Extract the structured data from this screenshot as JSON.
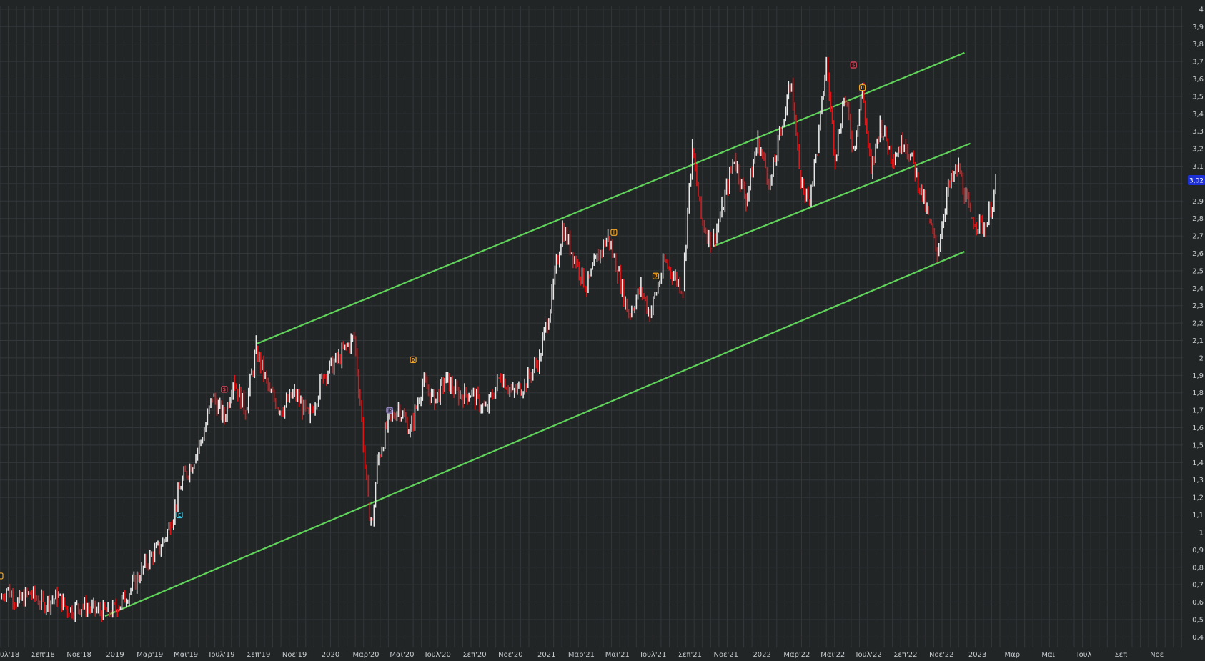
{
  "chart_data": {
    "type": "line",
    "title": "",
    "colors": {
      "background": "#222526",
      "grid": "#33373a",
      "axis_text": "#c9cccf",
      "price_up": "#e8e8e8",
      "price_down": "#d7191c",
      "trendline": "#5fd35a",
      "last_price_badge": "#1d2fd6"
    },
    "grid": true,
    "x_axis": {
      "type": "date",
      "range": [
        "2018-06-20",
        "2023-12-15"
      ],
      "ticks": [
        {
          "date": "2018-07-01",
          "label": "Ιουλ'18"
        },
        {
          "date": "2018-09-01",
          "label": "Σεπ'18"
        },
        {
          "date": "2018-11-01",
          "label": "Νοε'18"
        },
        {
          "date": "2019-01-01",
          "label": "2019"
        },
        {
          "date": "2019-03-01",
          "label": "Μαρ'19"
        },
        {
          "date": "2019-05-01",
          "label": "Μαι'19"
        },
        {
          "date": "2019-07-01",
          "label": "Ιουλ'19"
        },
        {
          "date": "2019-09-01",
          "label": "Σεπ'19"
        },
        {
          "date": "2019-11-01",
          "label": "Νοε'19"
        },
        {
          "date": "2020-01-01",
          "label": "2020"
        },
        {
          "date": "2020-03-01",
          "label": "Μαρ'20"
        },
        {
          "date": "2020-05-01",
          "label": "Μαι'20"
        },
        {
          "date": "2020-07-01",
          "label": "Ιουλ'20"
        },
        {
          "date": "2020-09-01",
          "label": "Σεπ'20"
        },
        {
          "date": "2020-11-01",
          "label": "Νοε'20"
        },
        {
          "date": "2021-01-01",
          "label": "2021"
        },
        {
          "date": "2021-03-01",
          "label": "Μαρ'21"
        },
        {
          "date": "2021-05-01",
          "label": "Μαι'21"
        },
        {
          "date": "2021-07-01",
          "label": "Ιουλ'21"
        },
        {
          "date": "2021-09-01",
          "label": "Σεπ'21"
        },
        {
          "date": "2021-11-01",
          "label": "Νοε'21"
        },
        {
          "date": "2022-01-01",
          "label": "2022"
        },
        {
          "date": "2022-03-01",
          "label": "Μαρ'22"
        },
        {
          "date": "2022-05-01",
          "label": "Μαι'22"
        },
        {
          "date": "2022-07-01",
          "label": "Ιουλ'22"
        },
        {
          "date": "2022-09-01",
          "label": "Σεπ'22"
        },
        {
          "date": "2022-11-01",
          "label": "Νοε'22"
        },
        {
          "date": "2023-01-01",
          "label": "2023"
        },
        {
          "date": "2023-03-01",
          "label": "Μαρ"
        },
        {
          "date": "2023-05-01",
          "label": "Μαι"
        },
        {
          "date": "2023-07-01",
          "label": "Ιουλ"
        },
        {
          "date": "2023-09-01",
          "label": "Σεπ"
        },
        {
          "date": "2023-11-01",
          "label": "Νοε"
        }
      ]
    },
    "y_axis": {
      "position": "right",
      "range": [
        0.34,
        4.02
      ],
      "ticks": [
        {
          "value": 0.4,
          "label": "0,4"
        },
        {
          "value": 0.5,
          "label": "0,5"
        },
        {
          "value": 0.6,
          "label": "0,6"
        },
        {
          "value": 0.7,
          "label": "0,7"
        },
        {
          "value": 0.8,
          "label": "0,8"
        },
        {
          "value": 0.9,
          "label": "0,9"
        },
        {
          "value": 1.0,
          "label": "1"
        },
        {
          "value": 1.1,
          "label": "1,1"
        },
        {
          "value": 1.2,
          "label": "1,2"
        },
        {
          "value": 1.3,
          "label": "1,3"
        },
        {
          "value": 1.4,
          "label": "1,4"
        },
        {
          "value": 1.5,
          "label": "1,5"
        },
        {
          "value": 1.6,
          "label": "1,6"
        },
        {
          "value": 1.7,
          "label": "1,7"
        },
        {
          "value": 1.8,
          "label": "1,8"
        },
        {
          "value": 1.9,
          "label": "1,9"
        },
        {
          "value": 2.0,
          "label": "2"
        },
        {
          "value": 2.1,
          "label": "2,1"
        },
        {
          "value": 2.2,
          "label": "2,2"
        },
        {
          "value": 2.3,
          "label": "2,3"
        },
        {
          "value": 2.4,
          "label": "2,4"
        },
        {
          "value": 2.5,
          "label": "2,5"
        },
        {
          "value": 2.6,
          "label": "2,6"
        },
        {
          "value": 2.7,
          "label": "2,7"
        },
        {
          "value": 2.8,
          "label": "2,8"
        },
        {
          "value": 2.9,
          "label": "2,9"
        },
        {
          "value": 3.0,
          "label": ""
        },
        {
          "value": 3.1,
          "label": "3,1"
        },
        {
          "value": 3.2,
          "label": "3,2"
        },
        {
          "value": 3.3,
          "label": "3,3"
        },
        {
          "value": 3.4,
          "label": "3,4"
        },
        {
          "value": 3.5,
          "label": "3,5"
        },
        {
          "value": 3.6,
          "label": "3,6"
        },
        {
          "value": 3.7,
          "label": "3,7"
        },
        {
          "value": 3.8,
          "label": "3,8"
        },
        {
          "value": 3.9,
          "label": "3,9"
        },
        {
          "value": 4.0,
          "label": "4"
        }
      ]
    },
    "last_price": {
      "value": 3.02,
      "label": "3,02"
    },
    "series": [
      {
        "x": [
          "2018-06-20",
          "2018-07-01",
          "2018-07-20",
          "2018-08-10",
          "2018-09-01",
          "2018-09-25",
          "2018-10-15",
          "2018-11-05",
          "2018-12-01",
          "2018-12-20",
          "2019-01-05",
          "2019-01-25",
          "2019-02-15",
          "2019-03-01",
          "2019-03-20",
          "2019-04-05",
          "2019-04-25",
          "2019-05-15",
          "2019-06-01",
          "2019-06-15",
          "2019-07-05",
          "2019-07-20",
          "2019-08-10",
          "2019-08-28",
          "2019-09-20",
          "2019-10-10",
          "2019-11-01",
          "2019-11-25",
          "2019-12-20",
          "2020-01-15",
          "2020-02-10",
          "2020-02-20",
          "2020-03-05",
          "2020-03-12",
          "2020-03-20",
          "2020-04-05",
          "2020-04-25",
          "2020-05-15",
          "2020-06-05",
          "2020-06-25",
          "2020-07-15",
          "2020-08-05",
          "2020-08-25",
          "2020-09-20",
          "2020-10-15",
          "2020-11-05",
          "2020-11-25",
          "2020-12-20",
          "2021-01-10",
          "2021-01-28",
          "2021-02-20",
          "2021-03-10",
          "2021-03-25",
          "2021-04-15",
          "2021-05-01",
          "2021-05-20",
          "2021-06-10",
          "2021-06-25",
          "2021-07-20",
          "2021-08-20",
          "2021-08-28",
          "2021-09-05",
          "2021-09-20",
          "2021-10-08",
          "2021-10-25",
          "2021-11-15",
          "2021-12-05",
          "2021-12-25",
          "2022-01-15",
          "2022-02-05",
          "2022-02-20",
          "2022-03-05",
          "2022-03-20",
          "2022-04-05",
          "2022-04-20",
          "2022-05-05",
          "2022-05-20",
          "2022-06-05",
          "2022-06-20",
          "2022-07-05",
          "2022-07-20",
          "2022-08-10",
          "2022-08-30",
          "2022-09-20",
          "2022-10-10",
          "2022-10-25",
          "2022-11-10",
          "2022-11-30",
          "2022-12-20",
          "2023-01-15",
          "2023-02-01"
        ],
        "y": [
          0.62,
          0.68,
          0.6,
          0.65,
          0.59,
          0.63,
          0.55,
          0.58,
          0.55,
          0.54,
          0.57,
          0.66,
          0.78,
          0.86,
          0.92,
          1.05,
          1.3,
          1.42,
          1.58,
          1.78,
          1.65,
          1.88,
          1.7,
          2.05,
          1.8,
          1.7,
          1.8,
          1.65,
          1.9,
          2.0,
          2.12,
          1.75,
          1.15,
          1.05,
          1.4,
          1.6,
          1.72,
          1.58,
          1.86,
          1.75,
          1.88,
          1.78,
          1.8,
          1.7,
          1.9,
          1.8,
          1.85,
          2.0,
          2.35,
          2.75,
          2.55,
          2.4,
          2.55,
          2.7,
          2.5,
          2.25,
          2.4,
          2.25,
          2.55,
          2.4,
          2.85,
          3.2,
          2.8,
          2.65,
          2.85,
          3.15,
          2.9,
          3.25,
          3.0,
          3.35,
          3.6,
          3.05,
          2.9,
          3.2,
          3.7,
          3.15,
          3.5,
          3.2,
          3.55,
          3.05,
          3.35,
          3.15,
          3.25,
          3.05,
          2.8,
          2.6,
          2.95,
          3.1,
          2.8,
          2.75,
          2.98
        ]
      }
    ],
    "trendlines": [
      {
        "name": "upper",
        "from": {
          "date": "2019-08-28",
          "value": 2.08
        },
        "to": {
          "date": "2022-12-10",
          "value": 3.75
        }
      },
      {
        "name": "lower",
        "from": {
          "date": "2018-12-15",
          "value": 0.52
        },
        "to": {
          "date": "2022-12-10",
          "value": 2.61
        }
      },
      {
        "name": "inner",
        "from": {
          "date": "2021-10-10",
          "value": 2.64
        },
        "to": {
          "date": "2022-12-20",
          "value": 3.23
        }
      }
    ],
    "event_markers": [
      {
        "date": "2018-06-20",
        "value": 0.75,
        "text": "",
        "color": "#f5a623"
      },
      {
        "date": "2019-04-20",
        "value": 1.1,
        "text": "E",
        "color": "#3ac5e0"
      },
      {
        "date": "2019-07-05",
        "value": 1.82,
        "text": "S",
        "color": "#e84a5f"
      },
      {
        "date": "2020-04-10",
        "value": 1.7,
        "text": "ES",
        "color": "#b8a6f0"
      },
      {
        "date": "2020-05-20",
        "value": 1.99,
        "text": "D",
        "color": "#f5a623"
      },
      {
        "date": "2021-04-25",
        "value": 2.72,
        "text": "E",
        "color": "#f5a623"
      },
      {
        "date": "2021-07-05",
        "value": 2.47,
        "text": "D",
        "color": "#f5a623"
      },
      {
        "date": "2022-06-05",
        "value": 3.68,
        "text": "S",
        "color": "#e84a5f"
      },
      {
        "date": "2022-06-20",
        "value": 3.55,
        "text": "D",
        "color": "#f5a623"
      }
    ]
  }
}
